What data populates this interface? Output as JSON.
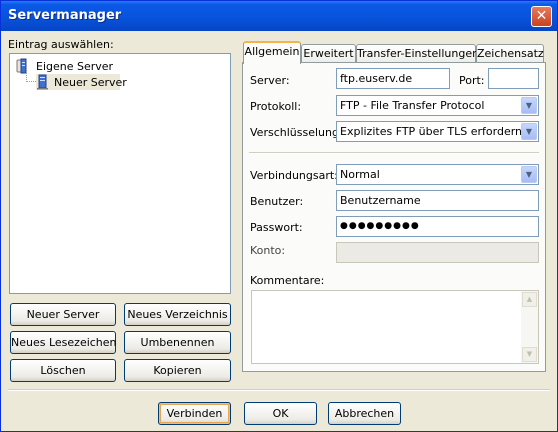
{
  "window": {
    "title": "Servermanager",
    "close_label": "✕"
  },
  "left": {
    "label": "Eintrag auswählen:",
    "tree": [
      {
        "label": "Eigene Server",
        "icon": "folder-server-icon"
      },
      {
        "label": "Neuer Server",
        "icon": "server-icon",
        "selected": true
      }
    ],
    "buttons": {
      "new_server": "Neuer Server",
      "new_folder": "Neues Verzeichnis",
      "new_bookmark": "Neues Lesezeichen",
      "rename": "Umbenennen",
      "delete": "Löschen",
      "copy": "Kopieren"
    }
  },
  "tabs": [
    {
      "label": "Allgemein",
      "active": true
    },
    {
      "label": "Erweitert"
    },
    {
      "label": "Transfer-Einstellungen"
    },
    {
      "label": "Zeichensatz"
    }
  ],
  "form": {
    "server_label": "Server:",
    "server_value": "ftp.euserv.de",
    "port_label": "Port:",
    "port_value": "",
    "protocol_label": "Protokoll:",
    "protocol_value": "FTP - File Transfer Protocol",
    "encryption_label": "Verschlüsselung:",
    "encryption_value": "Explizites FTP über TLS erfordern",
    "connection_label": "Verbindungsart:",
    "connection_value": "Normal",
    "user_label": "Benutzer:",
    "user_value": "Benutzername",
    "password_label": "Passwort:",
    "password_value": "●●●●●●●●●",
    "account_label": "Konto:",
    "account_value": "",
    "comments_label": "Kommentare:",
    "comments_value": ""
  },
  "footer": {
    "connect": "Verbinden",
    "ok": "OK",
    "cancel": "Abbrechen"
  },
  "colors": {
    "titlebar": "#0a59e6",
    "dialog_bg": "#ece9d8",
    "selection": "#ece9d8",
    "default_button_glow": "#f0c070"
  }
}
